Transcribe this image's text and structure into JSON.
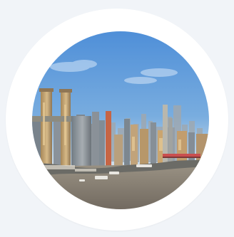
{
  "image": {
    "subject": "city-skyline-river-photo",
    "colors": {
      "page_bg": "#f1f4f8",
      "frame": "#ffffff",
      "sky_top": "#4f8fd8",
      "sky_mid": "#79addf",
      "sky_low": "#d9e4ec",
      "river": "#8a8276",
      "buildings_warm": "#c7a872",
      "buildings_gray": "#8f979e",
      "bridge": "#c94f4f"
    }
  }
}
